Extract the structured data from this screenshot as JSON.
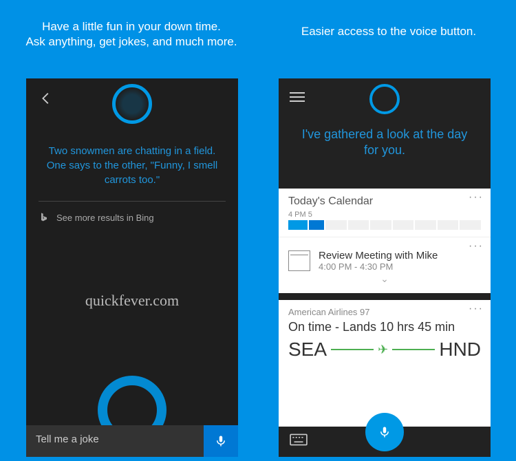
{
  "captions": {
    "left_line1": "Have a little fun in your down time.",
    "left_line2": "Ask anything, get jokes, and much more.",
    "right": "Easier access to the voice button."
  },
  "left_phone": {
    "response_line1": "Two snowmen are chatting in a field.",
    "response_line2": "One says to the other, \"Funny, I smell carrots too.\"",
    "bing_link": "See more results in Bing",
    "watermark": "quickfever.com",
    "input_value": "Tell me a joke"
  },
  "right_phone": {
    "greeting_line1": "I've gathered a look at the day",
    "greeting_line2": "for you.",
    "calendar": {
      "title": "Today's Calendar",
      "time_label": "4 PM  5",
      "meeting_title": "Review Meeting with Mike",
      "meeting_time": "4:00 PM - 4:30 PM"
    },
    "flight": {
      "airline": "American Airlines 97",
      "status": "On time - Lands 10 hrs 45 min",
      "from": "SEA",
      "to": "HND"
    }
  }
}
